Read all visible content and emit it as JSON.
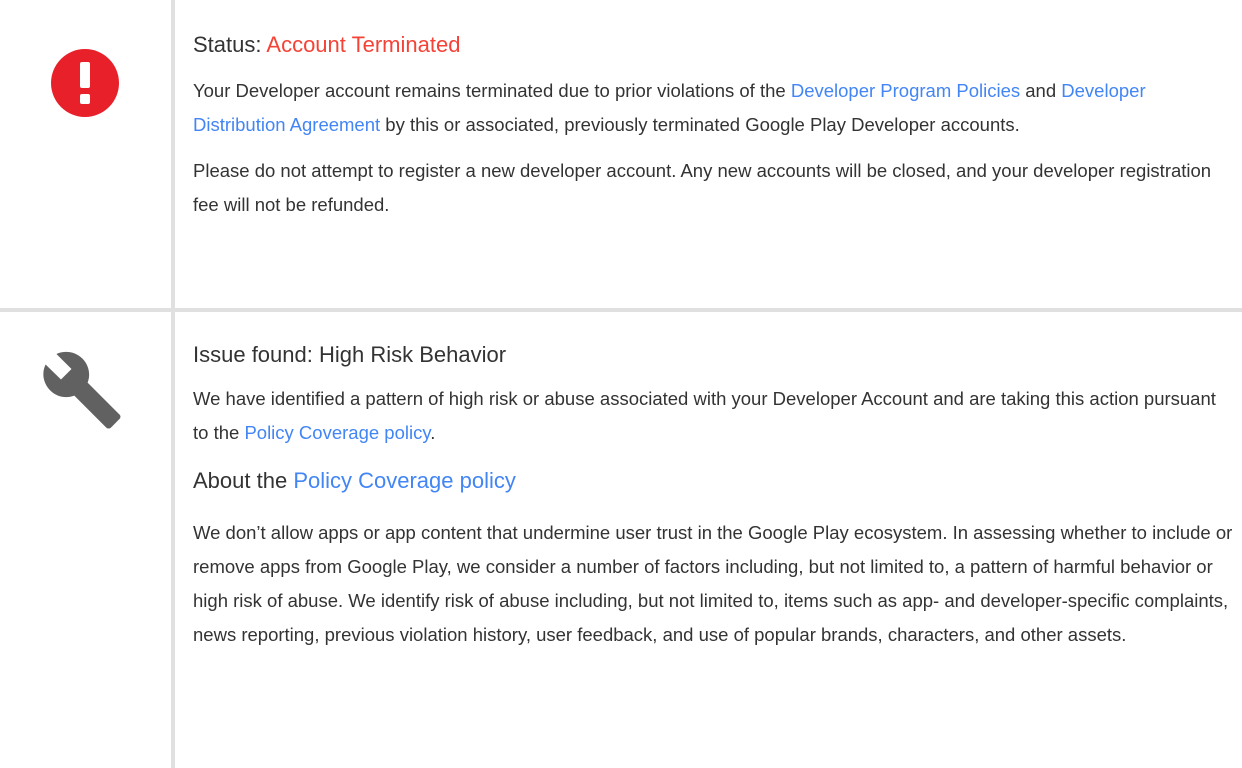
{
  "status_section": {
    "icon": "error-icon",
    "heading_label": "Status: ",
    "heading_value": "Account Terminated",
    "para1_text_a": "Your Developer account remains terminated due to prior violations of the ",
    "para1_link1": "Developer Program Policies",
    "para1_text_b": " and ",
    "para1_link2": "Developer Distribution Agreement",
    "para1_text_c": " by this or associated, previously terminated Google Play Developer accounts.",
    "para2_text": "Please do not attempt to register a new developer account. Any new accounts will be closed, and your developer registration fee will not be refunded."
  },
  "issue_section": {
    "icon": "wrench-icon",
    "heading": "Issue found: High Risk Behavior",
    "para1_text_a": "We have identified a pattern of high risk or abuse associated with your Developer Account and are taking this action pursuant to the ",
    "para1_link": "Policy Coverage policy",
    "para1_text_b": ".",
    "about_label": "About the ",
    "about_link": "Policy Coverage policy",
    "about_para": "We don’t allow apps or app content that undermine user trust in the Google Play ecosystem. In assessing whether to include or remove apps from Google Play, we consider a number of factors including, but not limited to, a pattern of harmful behavior or high risk of abuse. We identify risk of abuse including, but not limited to, items such as app- and developer-specific complaints, news reporting, previous violation history, user feedback, and use of popular brands, characters, and other assets."
  },
  "colors": {
    "error_red": "#e8202a",
    "status_red": "#f44336",
    "link_blue": "#4285f4",
    "icon_gray": "#616161",
    "divider": "#e0e0e0"
  }
}
